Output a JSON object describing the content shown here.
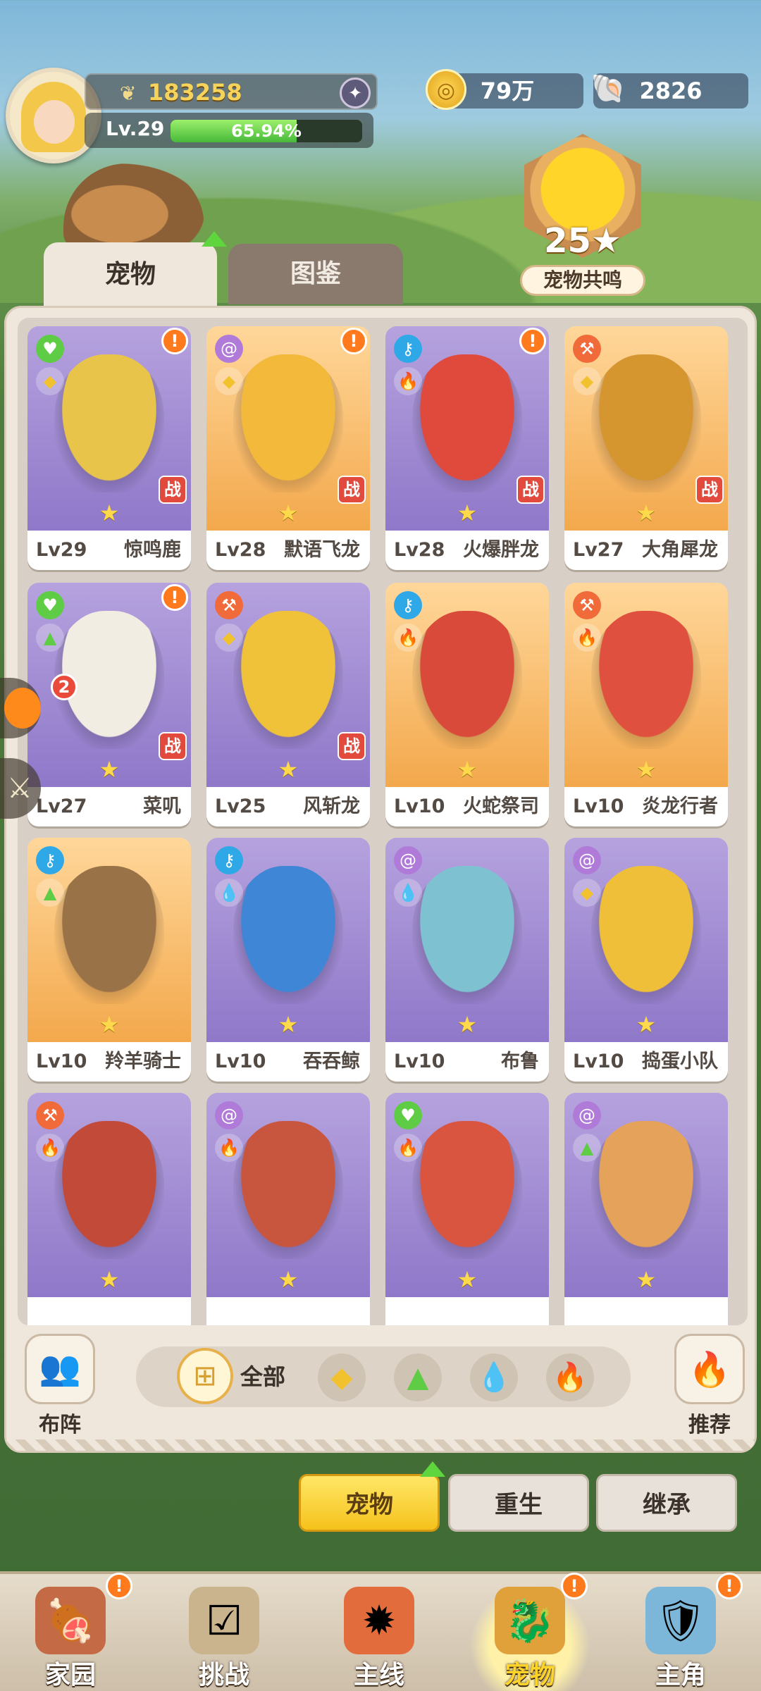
{
  "header": {
    "score": "183258",
    "level": "Lv.29",
    "progress_text": "65.94%",
    "progress": 0.6594,
    "gold": "79万",
    "shells": "2826"
  },
  "resonance": {
    "value": "25",
    "label": "宠物共鸣"
  },
  "tabs": [
    {
      "label": "宠物"
    },
    {
      "label": "图鉴"
    }
  ],
  "pets": [
    {
      "level": "Lv29",
      "name": "惊鸣鹿",
      "bg": "purple",
      "zhan": true,
      "alert": true,
      "color": "#e9c44a",
      "el1": "heart",
      "el2": "rock"
    },
    {
      "level": "Lv28",
      "name": "默语飞龙",
      "bg": "orange",
      "zhan": true,
      "alert": true,
      "color": "#f2b93a",
      "el1": "spiral",
      "el2": "rock"
    },
    {
      "level": "Lv28",
      "name": "火爆胖龙",
      "bg": "purple",
      "zhan": true,
      "alert": true,
      "color": "#e04a3c",
      "el1": "key",
      "el2": "fire"
    },
    {
      "level": "Lv27",
      "name": "大角犀龙",
      "bg": "orange",
      "zhan": true,
      "alert": false,
      "color": "#d5962f",
      "el1": "axe",
      "el2": "rock"
    },
    {
      "level": "Lv27",
      "name": "菜叽",
      "bg": "purple",
      "zhan": true,
      "alert": true,
      "color": "#f2ede2",
      "el1": "heart",
      "el2": "leaf"
    },
    {
      "level": "Lv25",
      "name": "风斩龙",
      "bg": "purple",
      "zhan": true,
      "alert": false,
      "color": "#f0c23a",
      "el1": "axe",
      "el2": "rock"
    },
    {
      "level": "Lv10",
      "name": "火蛇祭司",
      "bg": "orange",
      "zhan": false,
      "alert": false,
      "color": "#d94a3a",
      "el1": "key",
      "el2": "fire"
    },
    {
      "level": "Lv10",
      "name": "炎龙行者",
      "bg": "orange",
      "zhan": false,
      "alert": false,
      "color": "#e0503e",
      "el1": "axe",
      "el2": "fire"
    },
    {
      "level": "Lv10",
      "name": "羚羊骑士",
      "bg": "orange",
      "zhan": false,
      "alert": false,
      "color": "#9a7248",
      "el1": "key",
      "el2": "leaf"
    },
    {
      "level": "Lv10",
      "name": "吞吞鲸",
      "bg": "purple",
      "zhan": false,
      "alert": false,
      "color": "#3f86d6",
      "el1": "key",
      "el2": "water"
    },
    {
      "level": "Lv10",
      "name": "布鲁",
      "bg": "purple",
      "zhan": false,
      "alert": false,
      "color": "#7ec2d2",
      "el1": "spiral",
      "el2": "water"
    },
    {
      "level": "Lv10",
      "name": "捣蛋小队",
      "bg": "purple",
      "zhan": false,
      "alert": false,
      "color": "#efbf3a",
      "el1": "spiral",
      "el2": "rock"
    },
    {
      "level": "",
      "name": "",
      "bg": "purple",
      "zhan": false,
      "alert": false,
      "color": "#c24a38",
      "el1": "axe",
      "el2": "fire"
    },
    {
      "level": "",
      "name": "",
      "bg": "purple",
      "zhan": false,
      "alert": false,
      "color": "#c8563e",
      "el1": "spiral",
      "el2": "fire"
    },
    {
      "level": "",
      "name": "",
      "bg": "purple",
      "zhan": false,
      "alert": false,
      "color": "#d9553f",
      "el1": "heart",
      "el2": "fire"
    },
    {
      "level": "",
      "name": "",
      "bg": "purple",
      "zhan": false,
      "alert": false,
      "color": "#e4a25a",
      "el1": "spiral",
      "el2": "leaf"
    }
  ],
  "filter": {
    "formation": "布阵",
    "all": "全部",
    "recommend": "推荐"
  },
  "side": {
    "badge": "2"
  },
  "actions": {
    "pet": "宠物",
    "rebirth": "重生",
    "inherit": "继承"
  },
  "nav": [
    {
      "label": "家园",
      "icon": "home-icon"
    },
    {
      "label": "挑战",
      "icon": "challenge-icon"
    },
    {
      "label": "主线",
      "icon": "mainline-icon"
    },
    {
      "label": "宠物",
      "icon": "pet-icon"
    },
    {
      "label": "主角",
      "icon": "hero-icon"
    }
  ]
}
